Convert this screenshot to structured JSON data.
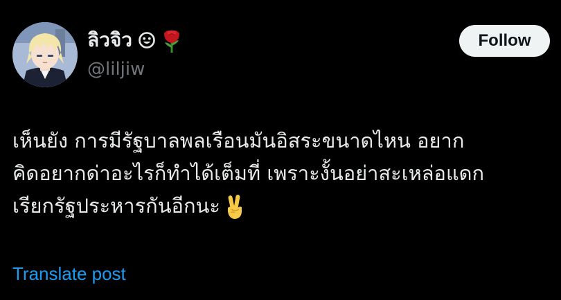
{
  "colors": {
    "background": "#000000",
    "text": "#e7e9ea",
    "muted": "#71767b",
    "link": "#1d9bf0",
    "follow_bg": "#eff3f4"
  },
  "author": {
    "display_name": "ลิวจิว",
    "emojis": [
      "smiling-face-icon",
      "rose-icon"
    ],
    "handle": "@liljiw",
    "avatar": "anime-character-avatar"
  },
  "actions": {
    "follow_label": "Follow"
  },
  "post": {
    "lines": [
      "เห็นยัง การมีรัฐบาลพลเรือนมันอิสระขนาดไหน อยาก",
      "คิดอยากด่าอะไรก็ทำได้เต็มที่ เพราะงั้นอย่าสะเหล่อแดก",
      "เรียกรัฐประหารกันอีกนะ"
    ],
    "trailing_emoji": "victory-hand-icon"
  },
  "translate": {
    "label": "Translate post"
  }
}
